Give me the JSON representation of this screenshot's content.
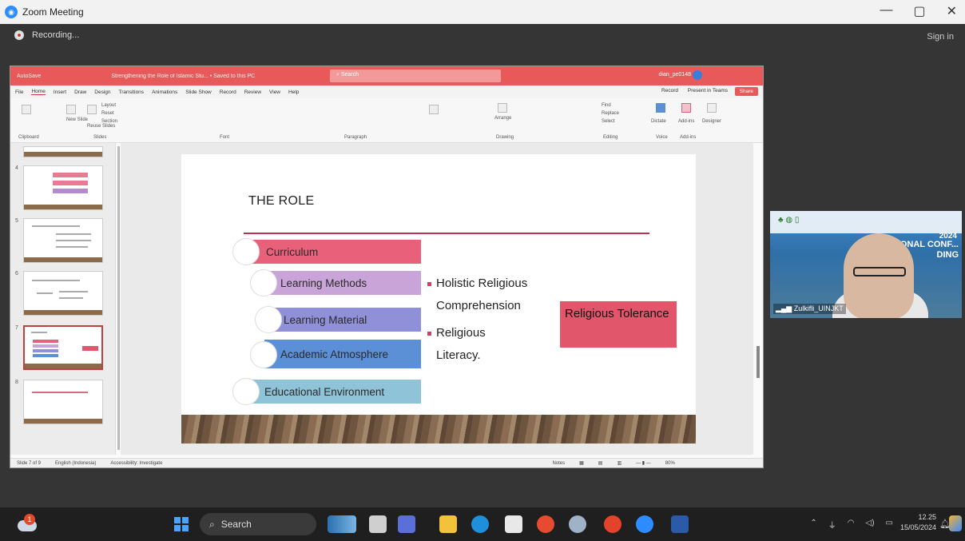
{
  "zoom": {
    "window_title": "Zoom Meeting",
    "recording_label": "Recording...",
    "sign_in": "Sign in",
    "min_glyph": "—",
    "max_glyph": "▢",
    "close_glyph": "✕"
  },
  "ppt": {
    "autosave": "AutoSave",
    "doc_title": "Strengthening the Role of Islamic Stu... • Saved to this PC",
    "search_placeholder": "Search",
    "user": "dian_pe0148",
    "menu": [
      "File",
      "Home",
      "Insert",
      "Draw",
      "Design",
      "Transitions",
      "Animations",
      "Slide Show",
      "Record",
      "Review",
      "View",
      "Help"
    ],
    "active_menu": "Home",
    "record_btn": "Record",
    "teams_btn": "Present in Teams",
    "share_btn": "Share",
    "ribbon_groups": [
      "Clipboard",
      "Slides",
      "Font",
      "Paragraph",
      "Drawing",
      "Editing",
      "Voice",
      "Add-ins"
    ],
    "ribbon_buttons": {
      "new_slide": "New Slide",
      "reuse": "Reuse Slides",
      "layout": "Layout",
      "reset": "Reset",
      "section": "Section",
      "arrange": "Arrange",
      "find": "Find",
      "replace": "Replace",
      "select": "Select",
      "dictate": "Dictate",
      "addins": "Add-ins",
      "designer": "Designer"
    },
    "status": {
      "slide_count": "Slide 7 of 9",
      "language": "English (Indonesia)",
      "accessibility": "Accessibility: Investigate",
      "notes": "Notes",
      "zoom_level": "80%"
    },
    "thumb_numbers": [
      "4",
      "5",
      "6",
      "7",
      "8"
    ]
  },
  "slide": {
    "title": "THE ROLE",
    "roles": [
      "Curriculum",
      "Learning Methods",
      "Learning Material",
      "Academic Atmosphere",
      "Educational Environment"
    ],
    "bullets": [
      {
        "line1": "Holistic Religious",
        "line2": "Comprehension"
      },
      {
        "line1": "Religious",
        "line2": "Literacy."
      }
    ],
    "outcome": "Religious Tolerance"
  },
  "video": {
    "participant": "Zulkifli_UINJKT",
    "banner": "GRADU... ONAL CONF... DING",
    "year": "2024"
  },
  "taskbar": {
    "weather_badge": "1",
    "search": "Search",
    "time": "12.25",
    "date": "15/05/2024"
  },
  "colors": {
    "curriculum": "#e8607a",
    "learning_methods": "#c9a4d8",
    "learning_material": "#9090d8",
    "academic_atmosphere": "#5b8fd6",
    "educational_environment": "#8fc3d8",
    "tolerance": "#e2566b",
    "ppt_accent": "#e85a5a"
  }
}
